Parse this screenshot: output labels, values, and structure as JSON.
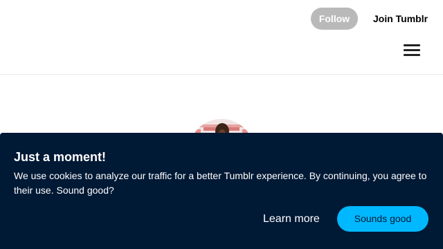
{
  "header": {
    "follow_label": "Follow",
    "join_label": "Join Tumblr",
    "menu_icon": "hamburger-menu-icon"
  },
  "profile": {
    "avatar_icon": "blog-avatar"
  },
  "cookie_banner": {
    "title": "Just a moment!",
    "message": "We use cookies to analyze our traffic for a better Tumblr experience. By continuing, you agree to their use. Sound good?",
    "learn_more_label": "Learn more",
    "accept_label": "Sounds good"
  },
  "colors": {
    "banner_bg": "#001935",
    "accept_bg": "#00b8ff",
    "follow_bg": "#b9b9b9"
  }
}
